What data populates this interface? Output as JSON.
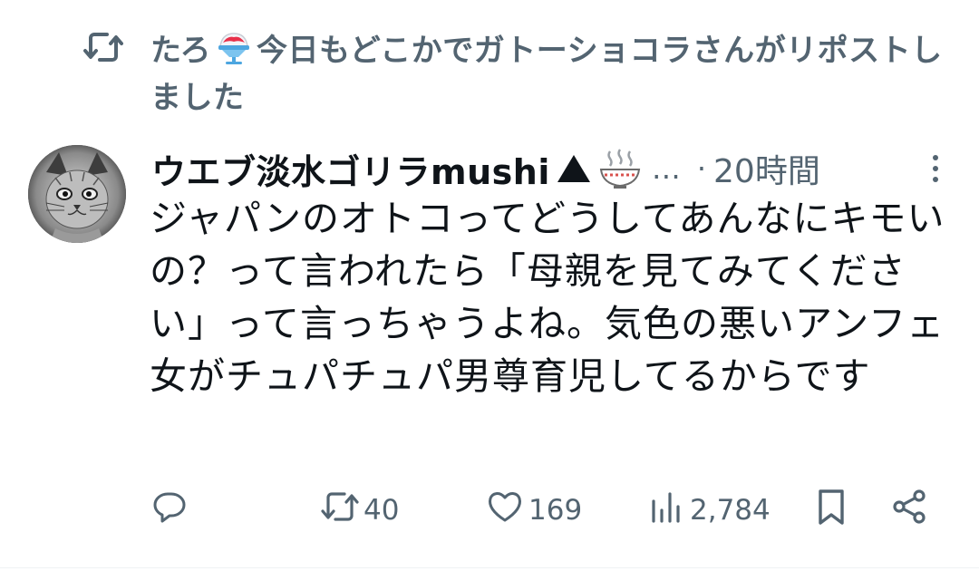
{
  "repost": {
    "icon": "repost-icon",
    "user_prefix": "たろ",
    "user_emoji": "shaved-ice-icon",
    "text": "今日もどこかでガトーショコラさんがリポストしました"
  },
  "author": {
    "avatar": "cat-sketch-avatar",
    "display_name": "ウエブ淡水ゴリラmushi",
    "name_emojis": [
      "black-triangle-icon",
      "hot-bowl-icon"
    ],
    "ellipsis": "…",
    "dot": "·",
    "timestamp": "20時間"
  },
  "post": {
    "text": "ジャパンのオトコってどうしてあんなにキモいの？って言われたら「母親を見てみてください」って言っちゃうよね。気色の悪いアンフェ女がチュパチュパ男尊育児してるからです"
  },
  "actions": {
    "replies": "",
    "reposts": "40",
    "likes": "169",
    "views": "2,784"
  },
  "colors": {
    "text_primary": "#0f1419",
    "text_secondary": "#536471",
    "background": "#ffffff"
  }
}
